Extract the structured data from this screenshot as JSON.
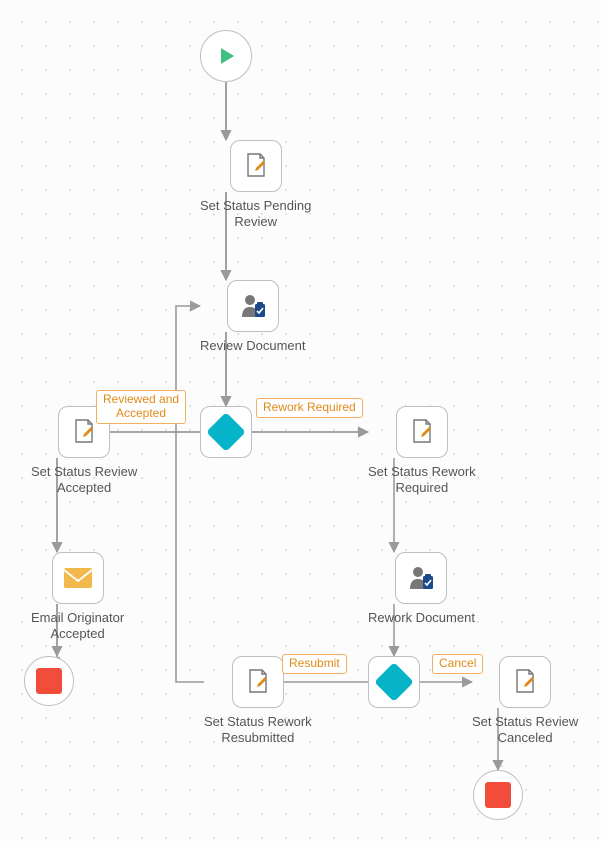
{
  "nodes": {
    "start": {
      "type": "start",
      "label": ""
    },
    "pending": {
      "type": "task-doc",
      "label": "Set Status Pending\nReview"
    },
    "review": {
      "type": "task-user",
      "label": "Review Document"
    },
    "gateway1": {
      "type": "gateway",
      "label": ""
    },
    "accepted": {
      "type": "task-doc",
      "label": "Set Status Review\nAccepted"
    },
    "reworkRequired": {
      "type": "task-doc",
      "label": "Set Status Rework\nRequired"
    },
    "email": {
      "type": "task-email",
      "label": "Email Originator\nAccepted"
    },
    "reworkDoc": {
      "type": "task-user",
      "label": "Rework Document"
    },
    "gateway2": {
      "type": "gateway",
      "label": ""
    },
    "resubmitted": {
      "type": "task-doc",
      "label": "Set Status Rework\nResubmitted"
    },
    "canceled": {
      "type": "task-doc",
      "label": "Set Status Review\nCanceled"
    },
    "end1": {
      "type": "end",
      "label": ""
    },
    "end2": {
      "type": "end",
      "label": ""
    }
  },
  "edgeLabels": {
    "reviewedAccepted": "Reviewed and\nAccepted",
    "reworkRequired": "Rework Required",
    "resubmit": "Resubmit",
    "cancel": "Cancel"
  }
}
